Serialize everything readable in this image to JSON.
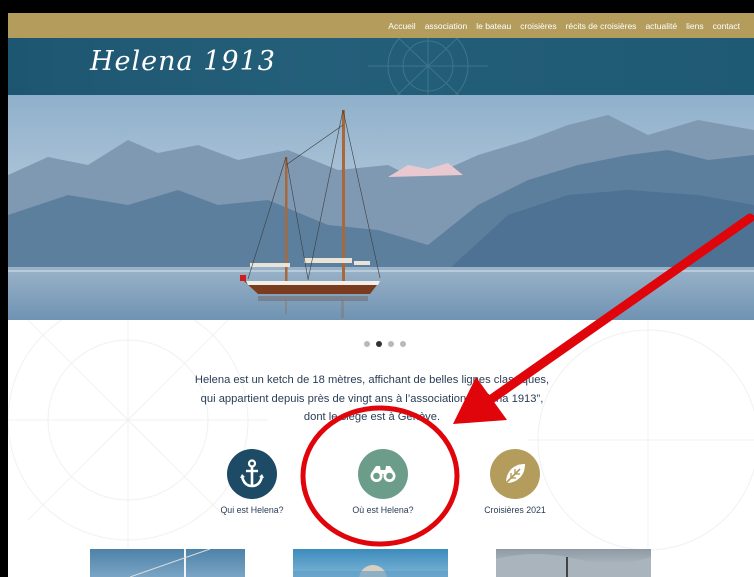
{
  "nav": {
    "items": [
      "Accueil",
      "association",
      "le bateau",
      "croisières",
      "récits de croisières",
      "actualité",
      "liens",
      "contact"
    ]
  },
  "header": {
    "logo_text": "Helena 1913"
  },
  "slider": {
    "dot_count": 4,
    "active_index": 1
  },
  "intro": {
    "line1": "Helena est un ketch de 18 mètres, affichant de belles lignes classiques,",
    "line2": "qui appartient depuis près de vingt ans à l’association “Helena 1913”,",
    "line3": "dont le siège est à Genève."
  },
  "features": [
    {
      "label": "Qui est Helena?",
      "icon": "anchor-icon",
      "color": "#1d4a64"
    },
    {
      "label": "Où est Helena?",
      "icon": "binoculars-icon",
      "color": "#6c9d8a"
    },
    {
      "label": "Croisières 2021",
      "icon": "leaf-icon",
      "color": "#b49d5c"
    }
  ],
  "colors": {
    "nav_bar": "#b49d5c",
    "header_band": "#1f5a74",
    "text": "#2a3d56",
    "annotation": "#e0040b"
  }
}
